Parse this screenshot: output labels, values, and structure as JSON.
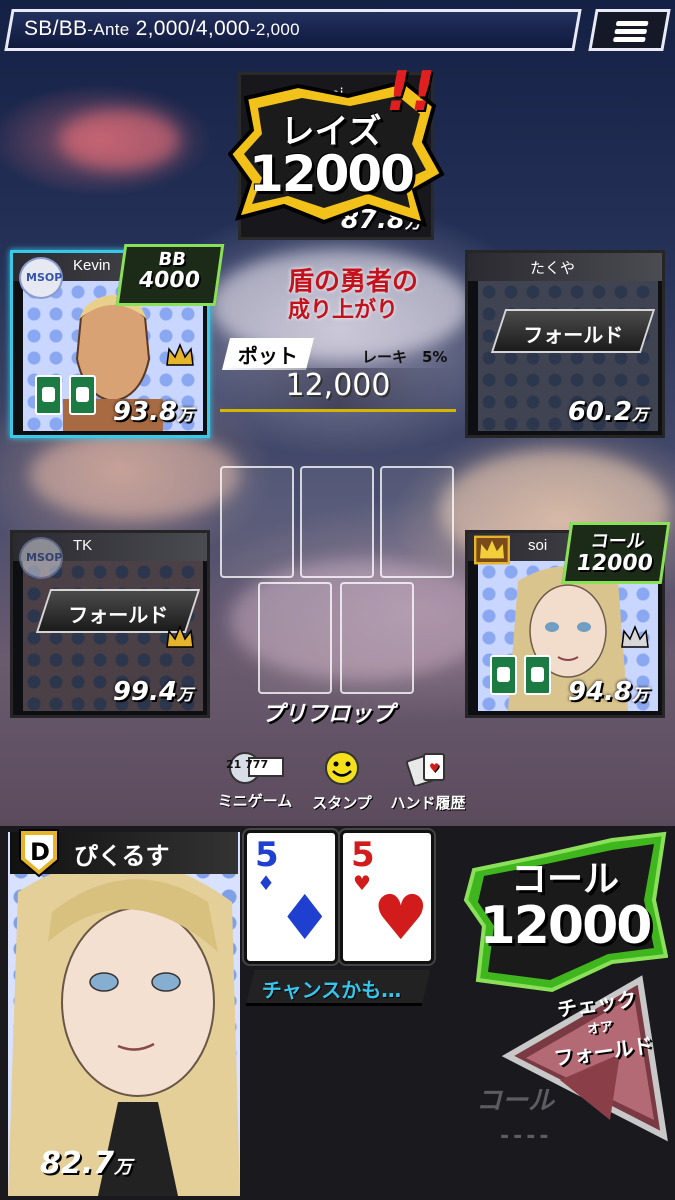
{
  "header": {
    "blinds_prefix": "SB/BB",
    "blinds_ante_label": "-Ante",
    "blinds_values": " 2,000/4,000",
    "ante_value": "-2,000"
  },
  "opponents": {
    "top": {
      "name": "noemi",
      "action_line1": "レイズ",
      "action_line2": "12000",
      "exclaim": "!!",
      "stack": "87.8",
      "unit": "万"
    },
    "left_top": {
      "logo": "MSOP",
      "name": "Kevin",
      "bet_line1": "BB",
      "bet_line2": "4000",
      "stack": "93.8",
      "unit": "万"
    },
    "right_top": {
      "name": "たくや",
      "action": "フォールド",
      "stack": "60.2",
      "unit": "万"
    },
    "left_bottom": {
      "logo": "MSOP",
      "name": "TK",
      "action": "フォールド",
      "stack": "99.4",
      "unit": "万"
    },
    "right_bottom": {
      "name": "soi",
      "bet_line1": "コール",
      "bet_line2": "12000",
      "stack": "94.8",
      "unit": "万"
    }
  },
  "table": {
    "anime_logo_line1": "盾の勇者の",
    "anime_logo_line2": "成り上がり",
    "pot_label": "ポット",
    "rake_label": "レーキ　5%",
    "pot_value": "12,000",
    "street": "プリフロップ"
  },
  "menu": {
    "mini_game": "ミニゲーム",
    "mini_game_badge": "21 777",
    "stamp": "スタンプ",
    "hand_history": "ハンド履歴"
  },
  "player": {
    "dealer_badge": "D",
    "name": "ぴくるす",
    "stack": "82.7",
    "unit": "万",
    "cards": [
      {
        "rank": "5",
        "suit": "♦",
        "color": "#1e3fcf"
      },
      {
        "rank": "5",
        "suit": "♥",
        "color": "#d21c1c"
      }
    ],
    "hint": "チャンスかも…"
  },
  "actions": {
    "call_line1": "コール",
    "call_line2": "12000",
    "check_or_fold_line1": "チェック",
    "check_or_fold_line2": "オア",
    "check_or_fold_line3": "フォールド",
    "call_dim_label": "コール",
    "call_dim_amount": "----"
  },
  "colors": {
    "active_seat": "#39c9e8",
    "bet_tag_border": "#8be05a",
    "raise_burst": "#f2c21b",
    "pot_underline": "#d4b600",
    "hint_text": "#33c7ee"
  }
}
